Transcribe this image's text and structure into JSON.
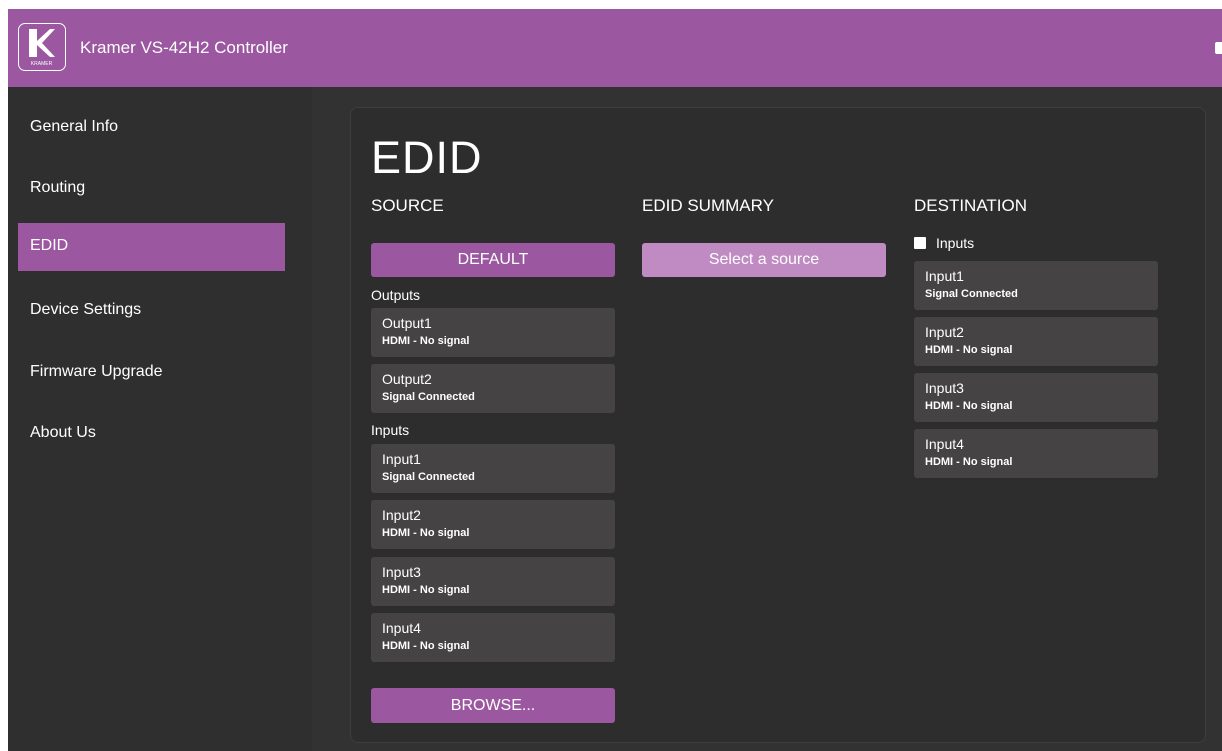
{
  "header": {
    "title": "Kramer VS-42H2 Controller",
    "logo_text": "KRAMER",
    "background_color": "#9b57a0"
  },
  "sidebar": {
    "items": [
      {
        "label": "General Info",
        "active": false
      },
      {
        "label": "Routing",
        "active": false
      },
      {
        "label": "EDID",
        "active": true
      },
      {
        "label": "Device Settings",
        "active": false
      },
      {
        "label": "Firmware Upgrade",
        "active": false
      },
      {
        "label": "About Us",
        "active": false
      }
    ]
  },
  "page": {
    "title": "EDID"
  },
  "source": {
    "heading": "SOURCE",
    "default_button": "DEFAULT",
    "outputs_label": "Outputs",
    "outputs": [
      {
        "name": "Output1",
        "status": "HDMI - No signal"
      },
      {
        "name": "Output2",
        "status": "Signal Connected"
      }
    ],
    "inputs_label": "Inputs",
    "inputs": [
      {
        "name": "Input1",
        "status": "Signal Connected"
      },
      {
        "name": "Input2",
        "status": "HDMI - No signal"
      },
      {
        "name": "Input3",
        "status": "HDMI - No signal"
      },
      {
        "name": "Input4",
        "status": "HDMI - No signal"
      }
    ],
    "browse_button": "BROWSE..."
  },
  "summary": {
    "heading": "EDID SUMMARY",
    "select_button": "Select a source"
  },
  "destination": {
    "heading": "DESTINATION",
    "inputs_checkbox_label": "Inputs",
    "inputs_checked": false,
    "inputs": [
      {
        "name": "Input1",
        "status": "Signal Connected"
      },
      {
        "name": "Input2",
        "status": "HDMI - No signal"
      },
      {
        "name": "Input3",
        "status": "HDMI - No signal"
      },
      {
        "name": "Input4",
        "status": "HDMI - No signal"
      }
    ]
  },
  "colors": {
    "accent": "#9b57a0",
    "accent_light": "#c08bc3",
    "background": "#333232",
    "card": "#454343"
  }
}
